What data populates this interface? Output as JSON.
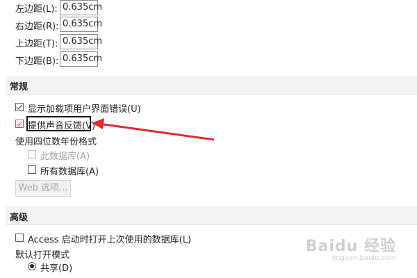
{
  "margins": {
    "left": {
      "label": "左边距(L):",
      "value": "0.635cm"
    },
    "right": {
      "label": "右边距(R):",
      "value": "0.635cm"
    },
    "top": {
      "label": "上边距(T):",
      "value": "0.635cm"
    },
    "bottom": {
      "label": "下边距(B):",
      "value": "0.635cm"
    }
  },
  "general": {
    "title": "常规",
    "show_addin_errors": {
      "label": "显示加载项用户界面错误(U)",
      "checked": true
    },
    "sound_feedback": {
      "label": "提供声音反馈(V)",
      "checked": true
    },
    "four_digit_year_label": "使用四位数年份格式",
    "this_database": {
      "label": "此数据库(A)",
      "checked": false,
      "disabled": true
    },
    "all_databases": {
      "label": "所有数据库(A)",
      "checked": false
    },
    "web_options_button": "Web 选项..."
  },
  "advanced": {
    "title": "高级",
    "open_last_db": {
      "label": "Access 启动时打开上次使用的数据库(L)",
      "checked": false
    },
    "default_open_mode_label": "默认打开模式",
    "shared": {
      "label": "共享(D)",
      "selected": true
    }
  },
  "annotation": {
    "arrow_color": "#e02b2b",
    "box_color": "#111111"
  },
  "watermark": {
    "brand": "Baidu 经验",
    "url": "jingyan.baidu.com"
  }
}
